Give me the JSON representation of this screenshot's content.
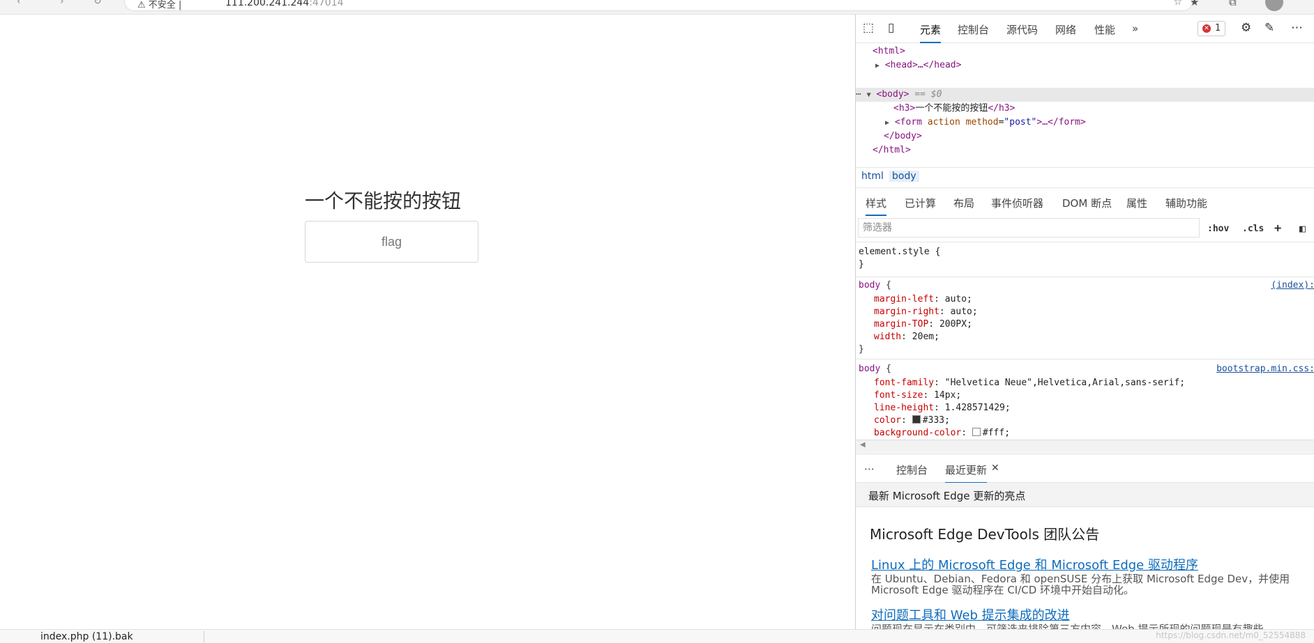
{
  "browser": {
    "security_label": "不安全",
    "url_host": "111.200.241.244",
    "url_port": ":47014",
    "separator": "|"
  },
  "page": {
    "heading": "一个不能按的按钮",
    "button_label": "flag"
  },
  "devtools": {
    "tabs": [
      "元素",
      "控制台",
      "源代码",
      "网络",
      "性能"
    ],
    "more_tabs": "»",
    "error_count": "1",
    "dom": {
      "html_open": "<html>",
      "head": "<head>…</head>",
      "body_open": "<body>",
      "body_marker": "== $0",
      "h3_open": "<h3>",
      "h3_text": "一个不能按的按钮",
      "h3_close": "</h3>",
      "form_tag": "<form",
      "form_attr_action": "action",
      "form_attr_method": "method",
      "form_method_value": "\"post\"",
      "form_rest": ">…</form>",
      "body_close": "</body>",
      "html_close": "</html>"
    },
    "breadcrumbs": [
      "html",
      "body"
    ],
    "subtabs": [
      "样式",
      "已计算",
      "布局",
      "事件侦听器",
      "DOM 断点",
      "属性",
      "辅助功能"
    ],
    "filter_placeholder": "筛选器",
    "filter_tools": [
      ":hov",
      ".cls",
      "+"
    ],
    "rules": {
      "element_style": {
        "selector": "element.style {",
        "close": "}"
      },
      "body_index": {
        "selector": "body",
        "source": "(index):",
        "props": [
          {
            "name": "margin-left",
            "value": "auto;"
          },
          {
            "name": "margin-right",
            "value": "auto;"
          },
          {
            "name": "margin-TOP",
            "value": "200PX;"
          },
          {
            "name": "width",
            "value": "20em;"
          }
        ]
      },
      "body_bootstrap": {
        "selector": "body",
        "source": "bootstrap.min.css:",
        "props": [
          {
            "name": "font-family",
            "value": "\"Helvetica Neue\",Helvetica,Arial,sans-serif;"
          },
          {
            "name": "font-size",
            "value": "14px;"
          },
          {
            "name": "line-height",
            "value": "1.428571429;"
          },
          {
            "name": "color",
            "value": "#333;"
          },
          {
            "name": "background-color",
            "value": "#fff;"
          }
        ]
      }
    },
    "colors": {
      "text_swatch": "#333333",
      "bg_swatch": "#ffffff",
      "accent": "#0f6cbd"
    },
    "drawer": {
      "tabs": [
        "控制台",
        "最近更新"
      ],
      "header": "最新 Microsoft Edge 更新的亮点",
      "title": "Microsoft Edge DevTools 团队公告",
      "items": [
        {
          "link": "Linux 上的 Microsoft Edge 和 Microsoft Edge 驱动程序",
          "desc": "在 Ubuntu、Debian、Fedora 和 openSUSE 分布上获取 Microsoft Edge Dev，并使用 Microsoft Edge 驱动程序在 CI/CD 环境中开始自动化。"
        },
        {
          "link": "对问题工具和 Web 提示集成的改进",
          "desc": "问题现在显示在类别中，可筛选来排除第三方内容。Web 提示所现的问题现是有趣些"
        }
      ]
    }
  },
  "downloads": {
    "file": "index.php (11).bak",
    "watermark": "https://blog.csdn.net/m0_52554888"
  }
}
